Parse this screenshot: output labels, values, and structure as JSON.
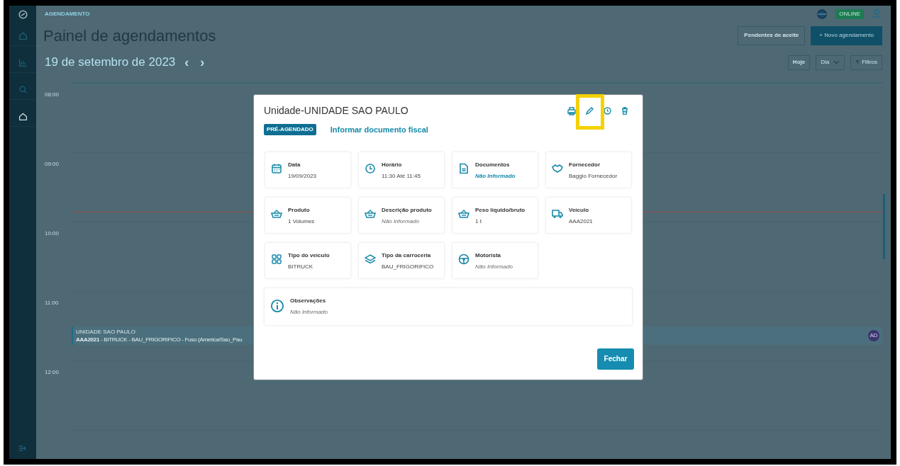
{
  "sidebar": {
    "items": [
      {
        "selected": false
      },
      {
        "selected": false
      },
      {
        "selected": false
      },
      {
        "selected": true
      }
    ]
  },
  "breadcrumb": "AGENDAMENTO",
  "header": {
    "status_badge": "ONLINE"
  },
  "title": "Painel de agendamentos",
  "actions": [
    "Pendentes de aceite",
    "+ Novo agendamento"
  ],
  "date_nav": {
    "date": "19 de setembro de 2023",
    "prev": "‹",
    "next": "›"
  },
  "view_controls": {
    "today": "Hoje",
    "view": "Dia",
    "filters": "Filtros"
  },
  "calendar": {
    "hours": [
      "08:00",
      "09:00",
      "10:00",
      "11:00",
      "12:00"
    ],
    "event": {
      "title": "UNIDADE SAO PAULO",
      "detail": "**AAA2021** - BITRUCK - BAU_FRIGORIFICO - Fuso (America/Sao_Pau",
      "avatar": "AD"
    }
  },
  "modal": {
    "title": "Unidade-UNIDADE SAO PAULO",
    "status": "PRÉ-AGENDADO",
    "link": "Informar documento fiscal",
    "close": "Fechar",
    "fields": [
      {
        "label": "Data",
        "value": "19/09/2023",
        "kind": "plain"
      },
      {
        "label": "Horário",
        "value": "11:30 Até 11:45",
        "kind": "plain"
      },
      {
        "label": "Documentos",
        "value": "Não Informado",
        "kind": "link"
      },
      {
        "label": "Fornecedor",
        "value": "Baggio Fornecedor",
        "kind": "plain"
      },
      {
        "label": "Produto",
        "value": "1 Volumes",
        "kind": "plain"
      },
      {
        "label": "Descrição produto",
        "value": "Não Informado",
        "kind": "muted"
      },
      {
        "label": "Peso líquido/bruto",
        "value": "1 t",
        "kind": "plain"
      },
      {
        "label": "Veículo",
        "value": "AAA2021",
        "kind": "plain"
      },
      {
        "label": "Tipo do veículo",
        "value": "BITRUCK",
        "kind": "plain"
      },
      {
        "label": "Tipo da carroceria",
        "value": "BAU_FRIGORIFICO",
        "kind": "plain"
      },
      {
        "label": "Motorista",
        "value": "Não Informado",
        "kind": "muted"
      }
    ],
    "notes": {
      "label": "Observações",
      "value": "Não Informado",
      "kind": "muted"
    }
  }
}
